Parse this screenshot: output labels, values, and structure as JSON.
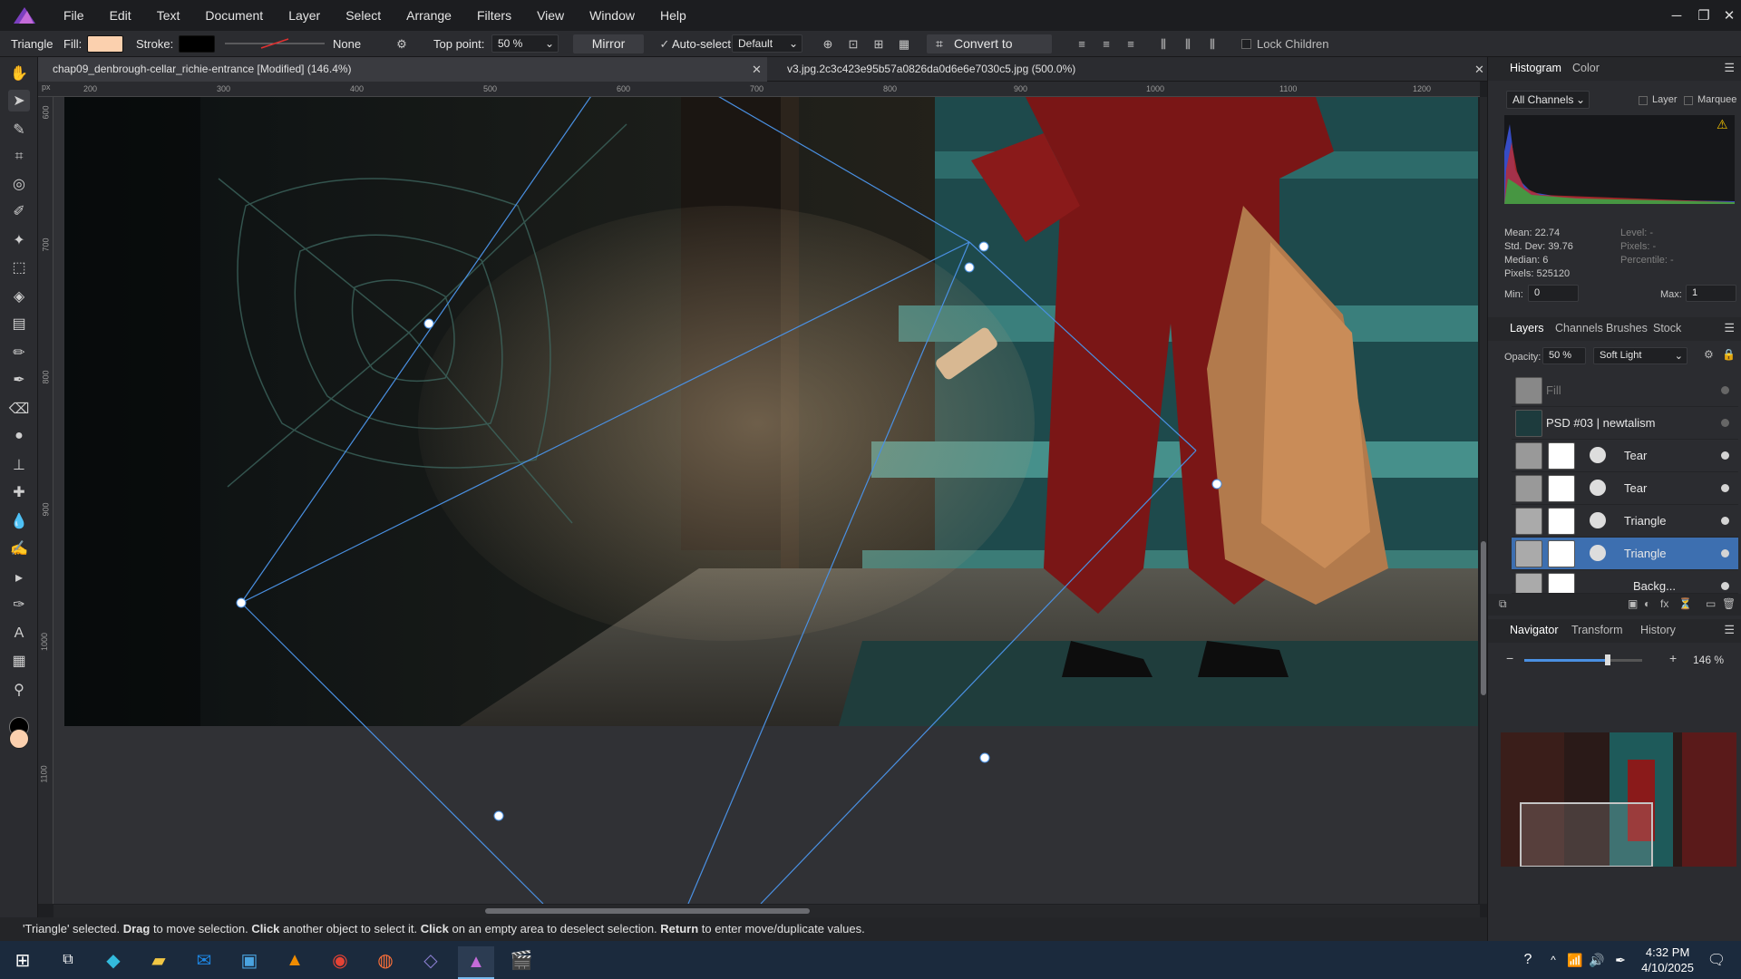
{
  "menu": {
    "items": [
      "File",
      "Edit",
      "Text",
      "Document",
      "Layer",
      "Select",
      "Arrange",
      "Filters",
      "View",
      "Window",
      "Help"
    ]
  },
  "window_controls": {
    "minimize": "─",
    "restore": "❐",
    "close": "✕"
  },
  "context_toolbar": {
    "tool_name": "Triangle",
    "fill_label": "Fill:",
    "fill_color": "#fbd0ae",
    "stroke_label": "Stroke:",
    "stroke_color": "#000000",
    "stroke_none": "None",
    "top_point_label": "Top point:",
    "top_point_value": "50 %",
    "mirror_label": "Mirror",
    "auto_select_label": "Auto-select:",
    "auto_select_value": "Default",
    "convert_label": "Convert to Curves",
    "lock_children_label": "Lock Children"
  },
  "tabs": [
    {
      "label": "chap09_denbrough-cellar_richie-entrance [Modified] (146.4%)",
      "close": "✕"
    },
    {
      "label": "v3.jpg.2c3c423e95b57a0826da0d6e6e7030c5.jpg (500.0%)",
      "close": "✕"
    }
  ],
  "rulers": {
    "unit": "px",
    "h_ticks": [
      "200",
      "300",
      "400",
      "500",
      "600",
      "700",
      "800",
      "900",
      "1000",
      "1100",
      "1200"
    ],
    "v_ticks": [
      "600",
      "700",
      "800",
      "900",
      "1000",
      "1100"
    ]
  },
  "status_bar": {
    "parts": [
      {
        "t": "'Triangle' selected. ",
        "b": false
      },
      {
        "t": "Drag",
        "b": true
      },
      {
        "t": " to move selection. ",
        "b": false
      },
      {
        "t": "Click",
        "b": true
      },
      {
        "t": " another object to select it. ",
        "b": false
      },
      {
        "t": "Click",
        "b": true
      },
      {
        "t": " on an empty area to deselect selection. ",
        "b": false
      },
      {
        "t": "Return",
        "b": true
      },
      {
        "t": " to enter move/duplicate values.",
        "b": false
      }
    ]
  },
  "histogram_panel": {
    "tabs": [
      "Histogram",
      "Color"
    ],
    "channel": "All Channels",
    "layer_cb": "Layer",
    "marquee_cb": "Marquee",
    "mean": "Mean: 22.74",
    "std_dev": "Std. Dev: 39.76",
    "median": "Median: 6",
    "pixels": "Pixels: 525120",
    "level": "Level: -",
    "pixels_r": "Pixels: -",
    "percentile": "Percentile: -",
    "min_label": "Min:",
    "min_value": "0",
    "max_label": "Max:",
    "max_value": "1",
    "warning_icon": "⚠"
  },
  "layers_panel": {
    "tabs": [
      "Layers",
      "Channels",
      "Brushes",
      "Stock"
    ],
    "opacity_label": "Opacity:",
    "opacity_value": "50 %",
    "blend_mode": "Soft Light",
    "layers": [
      {
        "name": "Fill",
        "selected": false
      },
      {
        "name": "PSD #03 | newtalism",
        "selected": false
      },
      {
        "name": "Tear",
        "selected": false
      },
      {
        "name": "Tear",
        "selected": false
      },
      {
        "name": "Triangle",
        "selected": false
      },
      {
        "name": "Triangle",
        "selected": true
      },
      {
        "name": "Backg...",
        "selected": false
      }
    ]
  },
  "navigator_panel": {
    "tabs": [
      "Navigator",
      "Transform",
      "History"
    ],
    "zoom_value": "146 %",
    "zoom_fraction": 0.71
  },
  "taskbar": {
    "time": "4:32 PM",
    "date": "4/10/2025"
  },
  "colors": {
    "selection_blue": "#4a90e2",
    "accent": "#3d6fb0"
  }
}
